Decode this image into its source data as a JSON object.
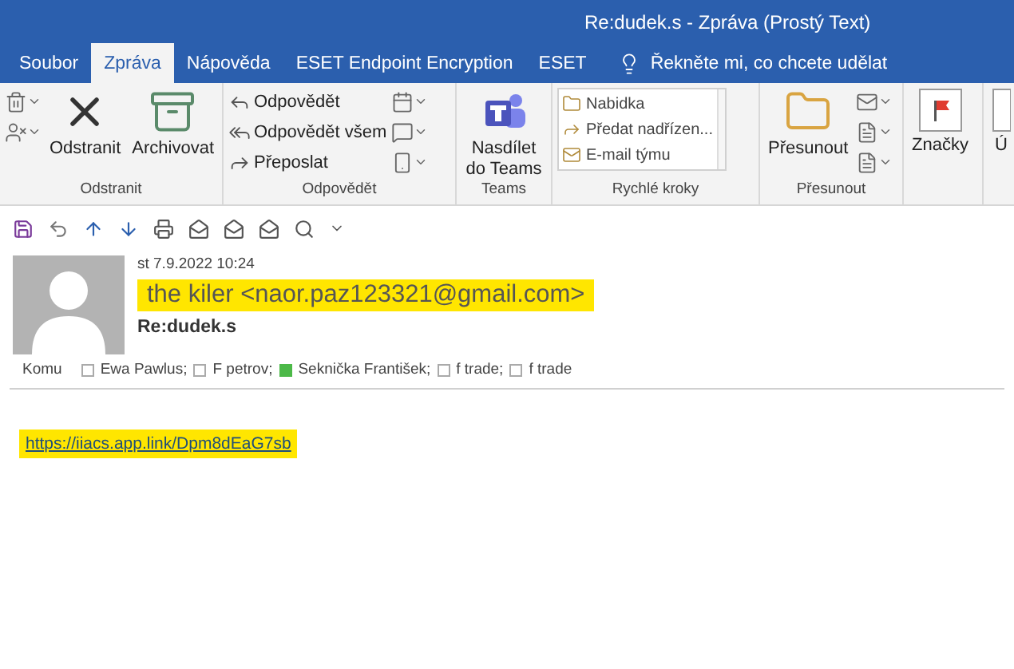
{
  "window": {
    "title": "Re:dudek.s  -  Zpráva (Prostý Text)"
  },
  "tabs": [
    {
      "label": "Soubor",
      "selected": false
    },
    {
      "label": "Zpráva",
      "selected": true
    },
    {
      "label": "Nápověda",
      "selected": false
    },
    {
      "label": "ESET Endpoint Encryption",
      "selected": false
    },
    {
      "label": "ESET",
      "selected": false
    }
  ],
  "tell_me": "Řekněte mi, co chcete udělat",
  "ribbon": {
    "groups": [
      {
        "label": "Odstranit",
        "items": [
          {
            "kind": "icons"
          },
          {
            "kind": "large",
            "label": "Odstranit"
          },
          {
            "kind": "large",
            "label": "Archivovat"
          }
        ]
      },
      {
        "label": "Odpovědět",
        "items": [
          {
            "kind": "small",
            "label": "Odpovědět"
          },
          {
            "kind": "small",
            "label": "Odpovědět všem"
          },
          {
            "kind": "small",
            "label": "Přeposlat"
          },
          {
            "kind": "icons"
          }
        ]
      },
      {
        "label": "Teams",
        "items": [
          {
            "kind": "large",
            "label": "Nasdílet do Teams"
          }
        ]
      },
      {
        "label": "Rychlé kroky",
        "items": [
          {
            "kind": "quick",
            "entries": [
              "Nabidka",
              "Předat nadřízen...",
              "E-mail týmu"
            ]
          }
        ]
      },
      {
        "label": "Přesunout",
        "items": [
          {
            "kind": "large",
            "label": "Přesunout"
          },
          {
            "kind": "icons"
          }
        ]
      },
      {
        "items": [
          {
            "kind": "large",
            "label": "Značky"
          }
        ]
      },
      {
        "items": [
          {
            "kind": "large",
            "label": "Ú"
          }
        ]
      }
    ]
  },
  "message": {
    "date": "st 7.9.2022 10:24",
    "sender": "the kiler <naor.paz123321@gmail.com>",
    "subject": "Re:dudek.s",
    "to_label": "Komu",
    "recipients": [
      {
        "name": "Ewa Pawlus;",
        "available": false
      },
      {
        "name": "F petrov;",
        "available": false
      },
      {
        "name": "Seknička František;",
        "available": true
      },
      {
        "name": "f trade;",
        "available": false
      },
      {
        "name": "f trade",
        "available": false
      }
    ],
    "body_link": "https://iiacs.app.link/Dpm8dEaG7sb"
  }
}
